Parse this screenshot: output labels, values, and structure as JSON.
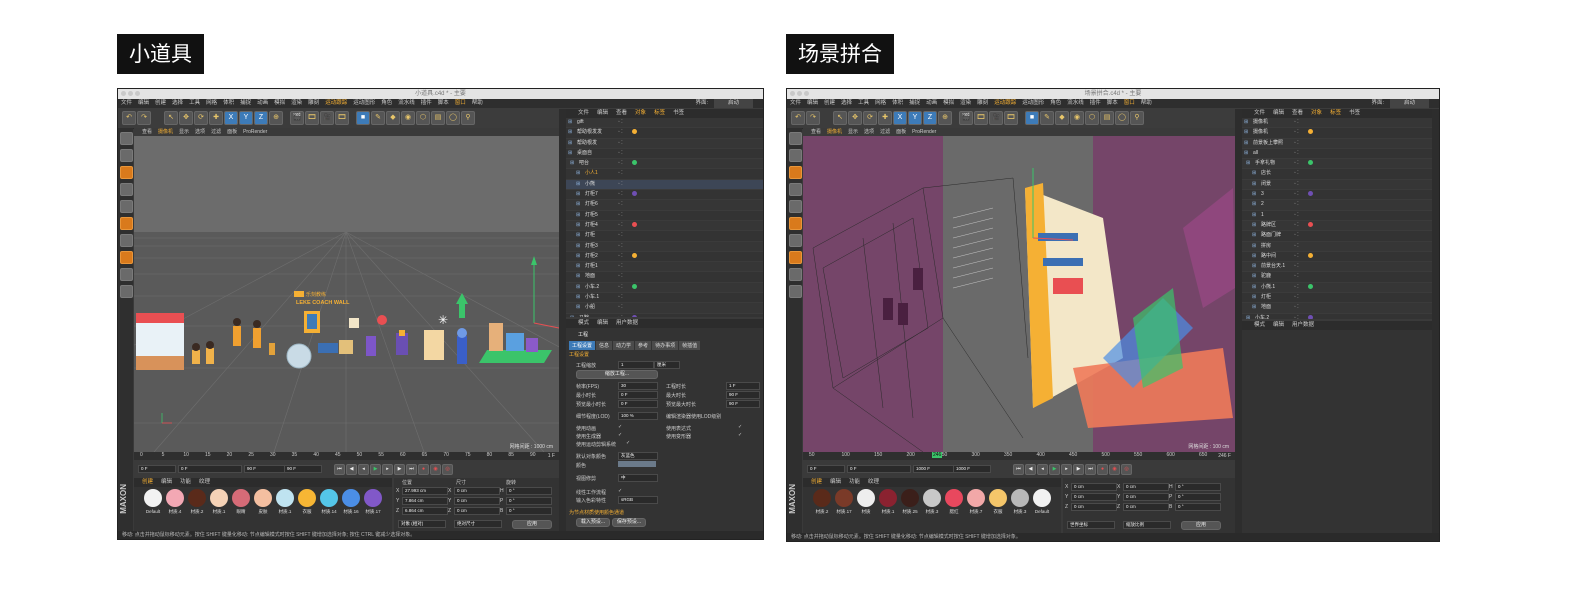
{
  "left_label": "小道具",
  "right_label": "场景拼合",
  "left_window": {
    "title": "小道具.c4d * - 主要",
    "menus": [
      "文件",
      "编辑",
      "创建",
      "选择",
      "工具",
      "网格",
      "体积",
      "捕捉",
      "动画",
      "模拟",
      "渲染",
      "雕刻",
      "运动跟踪",
      "运动图形",
      "角色",
      "流水线",
      "插件",
      "脚本",
      "窗口",
      "帮助"
    ],
    "menu_right": "界面:",
    "menu_right_value": "启动",
    "viewport_menu": [
      "查看",
      "摄像机",
      "显示",
      "选项",
      "过滤",
      "面板",
      "ProRender"
    ],
    "viewport_tag": "透视视图",
    "scene_sign": "LEKE COACH WALL",
    "scene_sign_small": "乐刻教练",
    "grid_readout": "网格间距 : 1000 cm",
    "object_tabs": [
      "文件",
      "编辑",
      "查看",
      "对象",
      "标签",
      "书签"
    ],
    "objects": [
      "gift",
      "帮助根发发",
      "帮助根发",
      "桌面自",
      "吧台",
      "小人1",
      "小熊",
      "灯柜7",
      "灯柜6",
      "灯柜5",
      "灯柜4",
      "灯柜",
      "灯柜3",
      "灯柜2",
      "灯柜1",
      "地面",
      "小车.2",
      "小车.1",
      "小船",
      "马鞍",
      "小车.3"
    ],
    "attr_tabs_header": [
      "模式",
      "编辑",
      "用户数据"
    ],
    "attr_title": "工程",
    "attr_tabs": [
      "工程设置",
      "信息",
      "动力学",
      "参考",
      "待办事项",
      "帧插值"
    ],
    "attr_section": "工程设置",
    "attr": {
      "scale_label": "工程缩放",
      "scale_value": "1",
      "scale_unit": "厘米",
      "scale_btn": "缩放工程...",
      "fps_label": "帧率(FPS)",
      "fps_value": "30",
      "min_time_label": "最小时长",
      "min_time_value": "0 F",
      "preview_min_label": "预览最小时长",
      "preview_min_value": "0 F",
      "lod_label": "细节程度(LOD)",
      "lod_value": "100 %",
      "project_time_label": "工程时长",
      "project_time_value": "1 F",
      "max_time_label": "最大时长",
      "max_time_value": "90 F",
      "preview_max_label": "预览最大时长",
      "preview_max_value": "90 F",
      "lod_render_label": "编辑渲染器使用LOD级别",
      "use_anim": "使用动画",
      "use_expr": "使用表达式",
      "use_gen": "使用生成器",
      "use_deform": "使用变形器",
      "use_motion": "使用运动剪辑系统",
      "default_color_label": "默认对象颜色",
      "default_color_value": "灰蓝色",
      "color_label": "颜色",
      "view_clip_label": "视图修剪",
      "view_clip_value": "中",
      "linear_label": "线性工作流程",
      "input_color_label": "输入色彩特性",
      "input_color_value": "sRGB",
      "node_label": "为节点材质使用颜色通道",
      "load_preset": "载入预设...",
      "save_preset": "保存预设..."
    },
    "timeline_ticks": [
      "0",
      "5",
      "10",
      "15",
      "20",
      "25",
      "30",
      "35",
      "40",
      "45",
      "50",
      "55",
      "60",
      "65",
      "70",
      "75",
      "80",
      "85",
      "90"
    ],
    "timeline_end": "1 F",
    "frame_fields": [
      "0 F",
      "0 F",
      "90 F",
      "90 F"
    ],
    "mat_tabs": [
      "创建",
      "编辑",
      "功能",
      "纹理"
    ],
    "materials": [
      {
        "name": "Default",
        "color": "#f2f2f2"
      },
      {
        "name": "材质.4",
        "color": "#f3a8b4"
      },
      {
        "name": "材质.2",
        "color": "#5a2a1a"
      },
      {
        "name": "材质.1",
        "color": "#f5d2b6"
      },
      {
        "name": "眼睛",
        "color": "#d66b77"
      },
      {
        "name": "皮肤",
        "color": "#f4bfa0"
      },
      {
        "name": "材质.1",
        "color": "#bfe3f0"
      },
      {
        "name": "衣服",
        "color": "#f7b634"
      },
      {
        "name": "材质.14",
        "color": "#54c6e8"
      },
      {
        "name": "材质.16",
        "color": "#4b8ee6"
      },
      {
        "name": "材质.17",
        "color": "#8158c8"
      }
    ],
    "coord_headers": [
      "位置",
      "尺寸",
      "旋转"
    ],
    "coords": [
      {
        "axis": "X",
        "pos": "27.993 cm",
        "size": "0 cm",
        "rot_axis": "H",
        "rot": "0 °"
      },
      {
        "axis": "Y",
        "pos": "7.864 cm",
        "size": "0 cm",
        "rot_axis": "P",
        "rot": "0 °"
      },
      {
        "axis": "Z",
        "pos": "6.864 cm",
        "size": "0 cm",
        "rot_axis": "B",
        "rot": "0 °"
      }
    ],
    "coord_mode": "对象 (相对)",
    "coord_size_mode": "绝对尺寸",
    "apply": "应用",
    "status": "移动: 点击并拖动鼠标移动元素。按住 SHIFT 键量化移动: 节点编辑模式时按住 SHIFT 键增加选择对象; 按住 CTRL 键减少选择对象。",
    "maxon": "MAXON"
  },
  "right_window": {
    "title": "场景拼合.c4d * - 主要",
    "menus": [
      "文件",
      "编辑",
      "创建",
      "选择",
      "工具",
      "网格",
      "体积",
      "捕捉",
      "动画",
      "模拟",
      "渲染",
      "雕刻",
      "运动跟踪",
      "运动图形",
      "角色",
      "流水线",
      "插件",
      "脚本",
      "窗口",
      "帮助"
    ],
    "menu_right": "界面:",
    "menu_right_value": "启动",
    "viewport_menu": [
      "查看",
      "摄像机",
      "显示",
      "选项",
      "过滤",
      "面板",
      "ProRender"
    ],
    "grid_readout": "网格间距 : 100 cm",
    "object_tabs": [
      "文件",
      "编辑",
      "查看",
      "对象",
      "标签",
      "书签"
    ],
    "objects": [
      "摄像机",
      "摄像机",
      "前景板上攀照",
      "all",
      "手拿礼物",
      "店长",
      "闭景",
      "3",
      "2",
      "1",
      "路牌区",
      "路面门牌",
      "拼房",
      "路中间",
      "前景台天.1",
      "驼鹿",
      "小熊.1",
      "灯柜",
      "地面",
      "小车.2"
    ],
    "attr_tabs_header": [
      "模式",
      "编辑",
      "用户数据"
    ],
    "timeline_ticks": [
      "50",
      "100",
      "150",
      "200",
      "250",
      "300",
      "350",
      "400",
      "450",
      "500",
      "550",
      "600",
      "650"
    ],
    "timeline_current": "246",
    "timeline_end": "246 F",
    "frame_fields": [
      "0 F",
      "0 F",
      "1000 F",
      "1000 F"
    ],
    "mat_tabs": [
      "创建",
      "编辑",
      "功能",
      "纹理"
    ],
    "materials": [
      {
        "name": "材质.2",
        "color": "#5a2a1a"
      },
      {
        "name": "材质.17",
        "color": "#7a3a28"
      },
      {
        "name": "材质",
        "color": "#eeeeee"
      },
      {
        "name": "材质.1",
        "color": "#8a2230"
      },
      {
        "name": "材质.25",
        "color": "#3b1f1a"
      },
      {
        "name": "材质.3",
        "color": "#c8c8c8"
      },
      {
        "name": "腮红",
        "color": "#e8485e"
      },
      {
        "name": "材质.7",
        "color": "#f2a8a8"
      },
      {
        "name": "衣服",
        "color": "#f5c66a"
      },
      {
        "name": "材质.3",
        "color": "#b8b8b8"
      },
      {
        "name": "Default",
        "color": "#f2f2f2"
      }
    ],
    "coords": [
      {
        "axis": "X",
        "pos": "0 cm",
        "size": "0 cm",
        "rot_axis": "H",
        "rot": "0 °"
      },
      {
        "axis": "Y",
        "pos": "0 cm",
        "size": "0 cm",
        "rot_axis": "P",
        "rot": "0 °"
      },
      {
        "axis": "Z",
        "pos": "0 cm",
        "size": "0 cm",
        "rot_axis": "B",
        "rot": "0 °"
      }
    ],
    "coord_mode": "世界坐标",
    "coord_size_mode": "缩放比例",
    "apply": "应用",
    "status": "移动: 点击并拖动鼠标移动元素。按住 SHIFT 键量化移动: 节点编辑模式时按住 SHIFT 键增加选择对象。",
    "maxon": "MAXON"
  },
  "colors": {
    "accent_orange": "#f5b034",
    "select_blue": "#3d7bb8",
    "viewport_gray": "#5e5e5e",
    "overlay_purple": "#7a3a6a"
  }
}
